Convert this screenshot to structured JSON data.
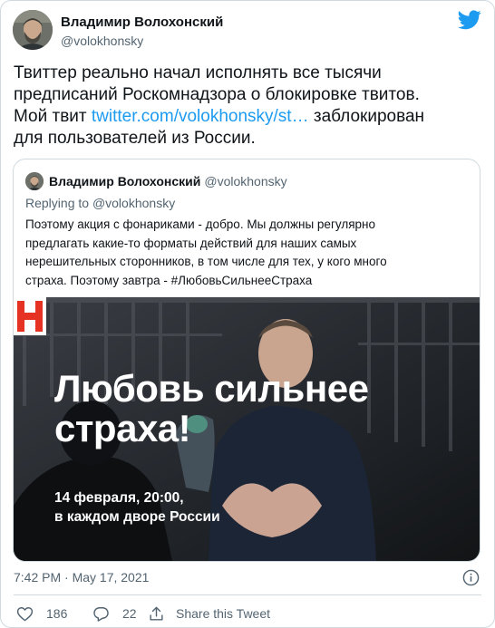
{
  "author": {
    "name": "Владимир Волохонский",
    "handle": "@volokhonsky"
  },
  "tweet": {
    "text_line1": "Твиттер реально начал исполнять все тысячи",
    "text_line2": "предписаний Роскомнадзора о блокировке твитов.",
    "text_line3_prefix": "Мой твит ",
    "link_text": "twitter.com/volokhonsky/st…",
    "text_line3_suffix": " заблокирован",
    "text_line4": "для пользователей из России."
  },
  "quoted": {
    "name": "Владимир Волохонский",
    "handle": "@volokhonsky",
    "replying_prefix": "Replying to ",
    "replying_to": "@volokhonsky",
    "text_line1": "Поэтому акция с фонариками - добро. Мы должны регулярно",
    "text_line2": "предлагать какие-то форматы действий для наших самых",
    "text_line3": "нерешительных сторонников, в том числе для тех, у кого много",
    "text_line4": "страха. Поэтому завтра - #ЛюбовьСильнееСтраха",
    "media": {
      "headline_line1": "Любовь сильнее",
      "headline_line2": "страха!",
      "date_line1": "14 февраля, 20:00,",
      "date_line2": "в каждом дворе России",
      "logo": "N"
    }
  },
  "meta": {
    "timestamp": "7:42 PM · May 17, 2021"
  },
  "actions": {
    "likes": "186",
    "replies": "22",
    "share_label": "Share this Tweet"
  },
  "colors": {
    "accent": "#1d9bf0",
    "text": "#0f1419",
    "secondary": "#536471",
    "border": "#cfd9de",
    "logo_red": "#e63223"
  },
  "icons": [
    "twitter-bird-icon",
    "info-icon",
    "heart-icon",
    "reply-icon",
    "share-icon"
  ]
}
